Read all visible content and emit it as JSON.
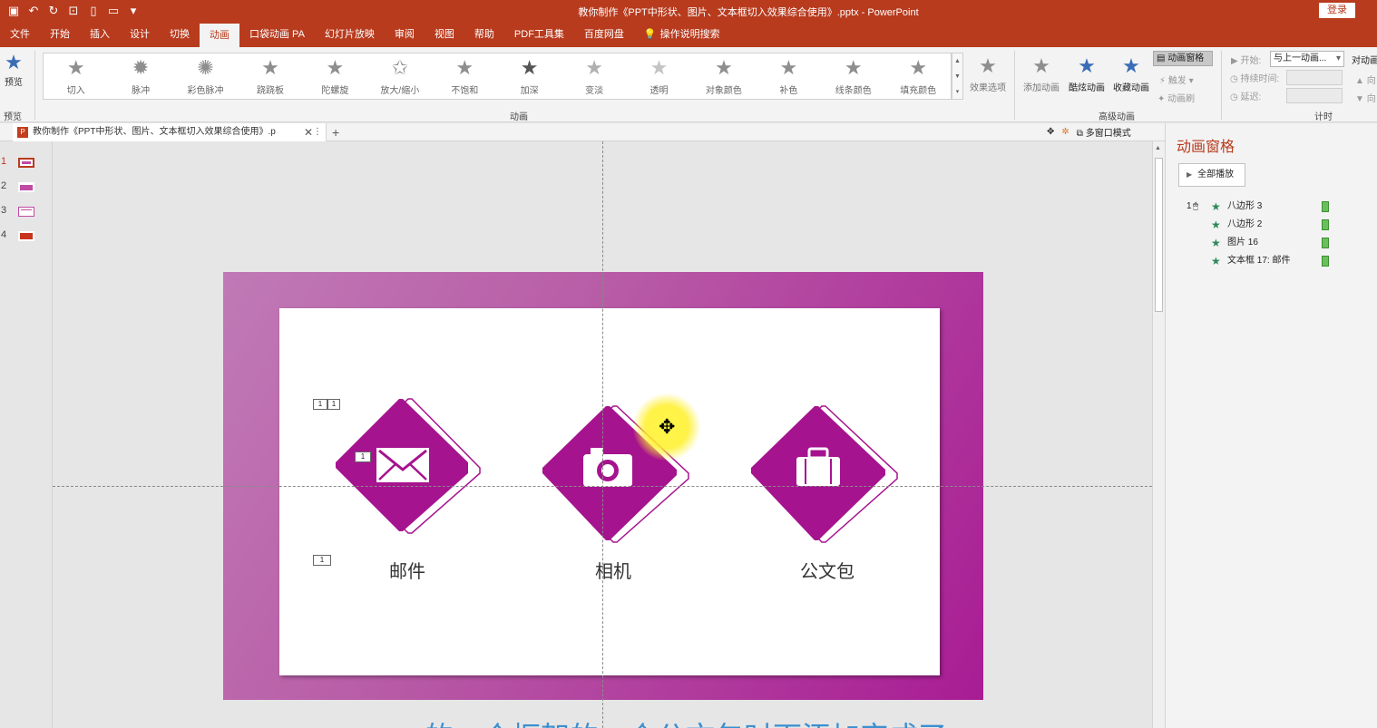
{
  "window": {
    "title": "教你制作《PPT中形状、图片、文本框切入效果综合使用》.pptx  -  PowerPoint",
    "login_label": "登录",
    "qat_icons": [
      "save-icon",
      "undo-icon",
      "redo-icon",
      "slideshow-icon",
      "new-icon",
      "open-icon",
      "customize-icon"
    ]
  },
  "tabs": [
    {
      "label": "文件"
    },
    {
      "label": "开始"
    },
    {
      "label": "插入"
    },
    {
      "label": "设计"
    },
    {
      "label": "切换"
    },
    {
      "label": "动画",
      "active": true
    },
    {
      "label": "口袋动画 PA"
    },
    {
      "label": "幻灯片放映"
    },
    {
      "label": "审阅"
    },
    {
      "label": "视图"
    },
    {
      "label": "帮助"
    },
    {
      "label": "PDF工具集"
    },
    {
      "label": "百度网盘"
    },
    {
      "label": "操作说明搜索"
    }
  ],
  "ribbon": {
    "preview_label": "预览",
    "preview_group": "预览",
    "animation_group": "动画",
    "advanced_group": "高级动画",
    "timing_group": "计时",
    "effects": [
      "切入",
      "脉冲",
      "彩色脉冲",
      "跷跷板",
      "陀螺旋",
      "放大/缩小",
      "不饱和",
      "加深",
      "变淡",
      "透明",
      "对象颜色",
      "补色",
      "线条颜色",
      "填充颜色"
    ],
    "effect_options": "效果选项",
    "add_animation": "添加动画",
    "cool_animation": "酷炫动画",
    "fav_animation": "收藏动画",
    "animation_pane_btn": "动画窗格",
    "trigger": "触发",
    "painter": "动画刷",
    "start_label": "开始:",
    "start_value": "与上一动画...",
    "duration_label": "持续时间:",
    "delay_label": "延迟:",
    "reorder_label": "对动画",
    "forward": "向",
    "backward": "向"
  },
  "docstrip": {
    "tab_title": "教你制作《PPT中形状、图片、文本框切入效果综合使用》.p",
    "close": "✕",
    "more": "⋮",
    "add": "+",
    "multiwin": "多窗口模式"
  },
  "thumbnails": [
    {
      "num": "1"
    },
    {
      "num": "2"
    },
    {
      "num": "3"
    },
    {
      "num": "4"
    }
  ],
  "slide": {
    "items": [
      {
        "caption": "邮件",
        "icon": "envelope-icon"
      },
      {
        "caption": "相机",
        "icon": "camera-icon"
      },
      {
        "caption": "公文包",
        "icon": "briefcase-icon"
      }
    ],
    "tags": [
      "1",
      "1",
      "1",
      "1"
    ],
    "bottom_text": "的一个框架的一个公文包时面添加完成了"
  },
  "anim_pane": {
    "title": "动画窗格",
    "play_all": "全部播放",
    "first_index": "1",
    "items": [
      {
        "label": "八边形 3"
      },
      {
        "label": "八边形 2"
      },
      {
        "label": "图片 16"
      },
      {
        "label": "文本框 17: 邮件"
      }
    ]
  },
  "colors": {
    "brand": "#b83b1e",
    "accent": "#a6138e",
    "star_green": "#2d8a5a"
  }
}
